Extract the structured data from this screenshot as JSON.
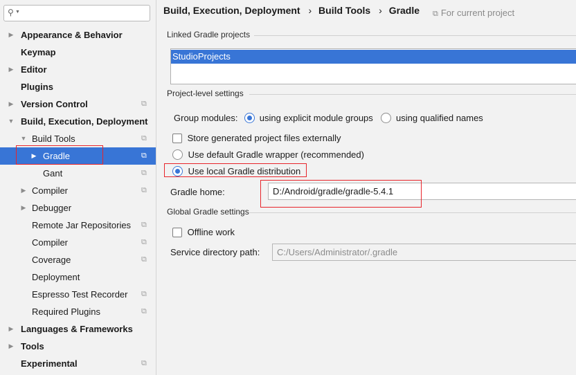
{
  "search": {
    "placeholder": ""
  },
  "sidebar": {
    "items": [
      {
        "label": "Appearance & Behavior",
        "bold": true,
        "arrow": "right",
        "proj": false
      },
      {
        "label": "Keymap",
        "bold": true,
        "arrow": "none",
        "proj": false
      },
      {
        "label": "Editor",
        "bold": true,
        "arrow": "right",
        "proj": false
      },
      {
        "label": "Plugins",
        "bold": true,
        "arrow": "none",
        "proj": false
      },
      {
        "label": "Version Control",
        "bold": true,
        "arrow": "right",
        "proj": true
      },
      {
        "label": "Build, Execution, Deployment",
        "bold": true,
        "arrow": "down",
        "proj": false
      },
      {
        "label": "Build Tools",
        "bold": false,
        "arrow": "down",
        "proj": true
      },
      {
        "label": "Gradle",
        "bold": false,
        "arrow": "right",
        "proj": true,
        "selected": true
      },
      {
        "label": "Gant",
        "bold": false,
        "arrow": "none",
        "proj": true
      },
      {
        "label": "Compiler",
        "bold": false,
        "arrow": "right",
        "proj": true
      },
      {
        "label": "Debugger",
        "bold": false,
        "arrow": "right",
        "proj": false
      },
      {
        "label": "Remote Jar Repositories",
        "bold": false,
        "arrow": "none",
        "proj": true
      },
      {
        "label": "Compiler",
        "bold": false,
        "arrow": "none",
        "proj": true
      },
      {
        "label": "Coverage",
        "bold": false,
        "arrow": "none",
        "proj": true
      },
      {
        "label": "Deployment",
        "bold": false,
        "arrow": "none",
        "proj": false
      },
      {
        "label": "Espresso Test Recorder",
        "bold": false,
        "arrow": "none",
        "proj": true
      },
      {
        "label": "Required Plugins",
        "bold": false,
        "arrow": "none",
        "proj": true
      },
      {
        "label": "Languages & Frameworks",
        "bold": true,
        "arrow": "right",
        "proj": false
      },
      {
        "label": "Tools",
        "bold": true,
        "arrow": "right",
        "proj": false
      },
      {
        "label": "Experimental",
        "bold": true,
        "arrow": "none",
        "proj": true
      }
    ]
  },
  "header": {
    "crumb1": "Build, Execution, Deployment",
    "crumb2": "Build Tools",
    "crumb3": "Gradle",
    "separator": "›",
    "for_current": "For current project"
  },
  "linked": {
    "title": "Linked Gradle projects",
    "projects": [
      "StudioProjects"
    ]
  },
  "project_level": {
    "title": "Project-level settings",
    "group_modules_label": "Group modules:",
    "opt_explicit": "using explicit module groups",
    "opt_qualified": "using qualified names",
    "store_external": "Store generated project files externally",
    "use_default_wrapper": "Use default Gradle wrapper (recommended)",
    "use_local": "Use local Gradle distribution",
    "gradle_home_label": "Gradle home:",
    "gradle_home_value": "D:/Android/gradle/gradle-5.4.1"
  },
  "global": {
    "title": "Global Gradle settings",
    "offline": "Offline work",
    "service_dir_label": "Service directory path:",
    "service_dir_value": "C:/Users/Administrator/.gradle"
  },
  "colors": {
    "accent": "#3875d6",
    "highlight_box": "#e8242a"
  }
}
